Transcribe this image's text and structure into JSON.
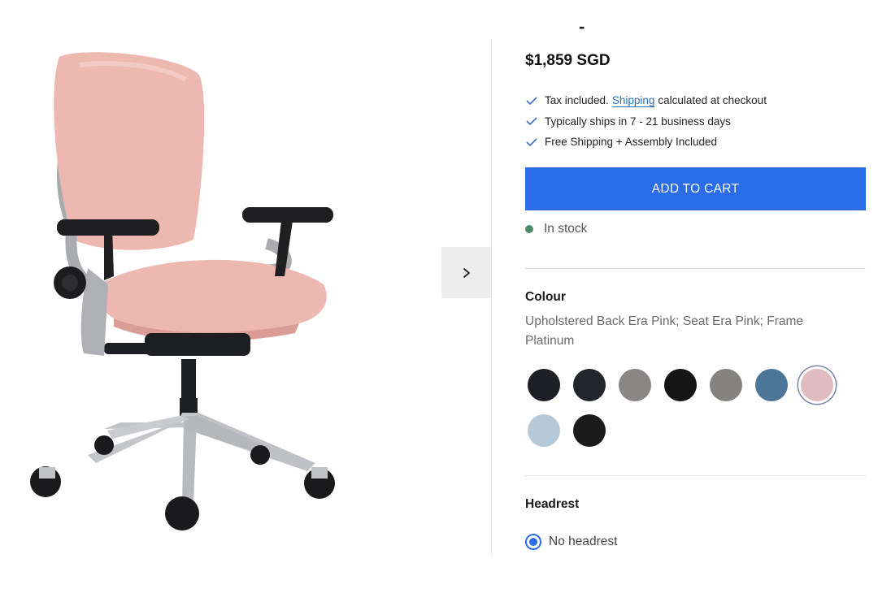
{
  "product": {
    "title_fragment": "-",
    "price": "$1,859 SGD",
    "info": [
      {
        "before": "Tax included.",
        "link": "Shipping",
        "after": "calculated at checkout"
      },
      {
        "before": "Typically ships in 7 - 21 business days"
      },
      {
        "before": "Free Shipping + Assembly Included"
      }
    ],
    "add_to_cart_label": "ADD TO CART",
    "stock_label": "In stock",
    "stock_color": "#4a8c6a"
  },
  "colour": {
    "label": "Colour",
    "selected_description": "Upholstered Back Era Pink; Seat Era Pink; Frame Platinum",
    "swatches": [
      {
        "color": "#1e1f24",
        "selected": false
      },
      {
        "color": "#23252c",
        "selected": false
      },
      {
        "color": "#8a8685",
        "selected": false
      },
      {
        "color": "#151515",
        "selected": false
      },
      {
        "color": "#858380",
        "selected": false
      },
      {
        "color": "#4d7595",
        "selected": false
      },
      {
        "color": "#e0bcc0",
        "selected": true
      },
      {
        "color": "#b6c9d9",
        "selected": false
      },
      {
        "color": "#1b1b1c",
        "selected": false
      }
    ]
  },
  "headrest": {
    "label": "Headrest",
    "option_label": "No headrest",
    "option_selected": true
  },
  "gallery": {
    "next_icon": "chevron-right-icon",
    "image": "pink-office-chair"
  },
  "colors": {
    "accent": "#2b6de8",
    "link": "#2a6fb8"
  }
}
